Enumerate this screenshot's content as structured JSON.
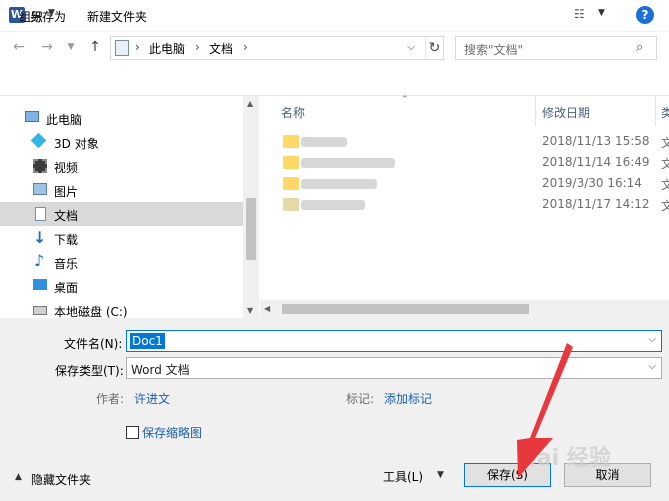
{
  "window": {
    "title": "另存为",
    "app_icon": "W",
    "close_glyph": "✕"
  },
  "address": {
    "crumbs": [
      "此电脑",
      "文档"
    ],
    "search_placeholder": "搜索\"文档\""
  },
  "toolbar": {
    "organize": "组织",
    "new_folder": "新建文件夹",
    "help": "?"
  },
  "nav": {
    "items": [
      {
        "label": "此电脑",
        "icon": "computer-icon"
      },
      {
        "label": "3D 对象",
        "icon": "cube-icon"
      },
      {
        "label": "视频",
        "icon": "video-icon"
      },
      {
        "label": "图片",
        "icon": "picture-icon"
      },
      {
        "label": "文档",
        "icon": "document-icon",
        "selected": true
      },
      {
        "label": "下载",
        "icon": "download-icon"
      },
      {
        "label": "音乐",
        "icon": "music-icon"
      },
      {
        "label": "桌面",
        "icon": "desktop-icon"
      },
      {
        "label": "本地磁盘 (C:)",
        "icon": "drive-icon"
      }
    ]
  },
  "list": {
    "columns": {
      "name": "名称",
      "modified": "修改日期",
      "type": "类"
    },
    "rows": [
      {
        "date": "2018/11/13 15:58",
        "type": "文"
      },
      {
        "date": "2018/11/14 16:49",
        "type": "文"
      },
      {
        "date": "2019/3/30 16:14",
        "type": "文"
      },
      {
        "date": "2018/11/17 14:12",
        "type": "文"
      }
    ]
  },
  "form": {
    "filename_label": "文件名(N):",
    "filename_value": "Doc1",
    "filetype_label": "保存类型(T):",
    "filetype_value": "Word 文档",
    "author_label": "作者:",
    "author_value": "许进文",
    "tags_label": "标记:",
    "tags_value": "添加标记",
    "thumbnail_label": "保存缩略图"
  },
  "footer": {
    "hide_folders": "隐藏文件夹",
    "tools": "工具(L)",
    "save": "保存(S)",
    "cancel": "取消"
  },
  "watermark": "Bai 经验",
  "colors": {
    "accent": "#0078d7",
    "annotation_arrow": "#e8383d",
    "folder": "#ffd866"
  }
}
